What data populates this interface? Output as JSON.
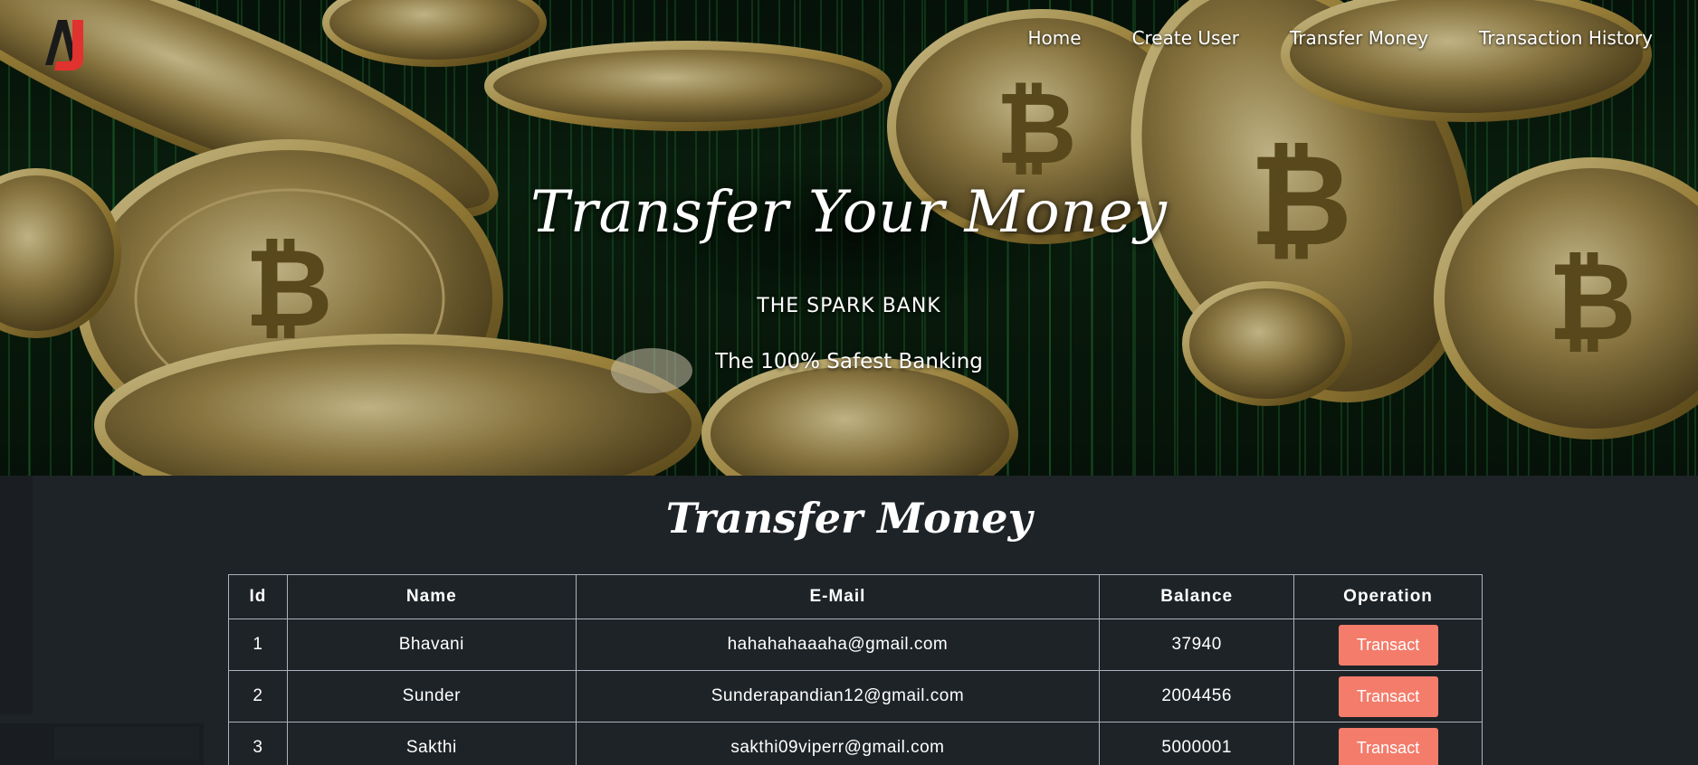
{
  "brand": {
    "logo_icon": "aj-logo-icon",
    "accent": "#e0322e"
  },
  "nav": {
    "items": [
      {
        "label": "Home"
      },
      {
        "label": "Create User"
      },
      {
        "label": "Transfer Money"
      },
      {
        "label": "Transaction History"
      }
    ]
  },
  "hero": {
    "title": "Transfer Your Money",
    "subtitle": "THE SPARK BANK",
    "tagline": "The 100% Safest Banking"
  },
  "main": {
    "title": "Transfer Money",
    "table": {
      "headers": [
        "Id",
        "Name",
        "E-Mail",
        "Balance",
        "Operation"
      ],
      "rows": [
        {
          "id": "1",
          "name": "Bhavani",
          "email": "hahahahaaaha@gmail.com",
          "balance": "37940",
          "action": "Transact"
        },
        {
          "id": "2",
          "name": "Sunder",
          "email": "Sunderapandian12@gmail.com",
          "balance": "2004456",
          "action": "Transact"
        },
        {
          "id": "3",
          "name": "Sakthi",
          "email": "sakthi09viperr@gmail.com",
          "balance": "5000001",
          "action": "Transact"
        }
      ]
    }
  },
  "colors": {
    "page_bg": "#1e2327",
    "button_bg": "#f47c6b",
    "table_border": "#aab3bb"
  }
}
